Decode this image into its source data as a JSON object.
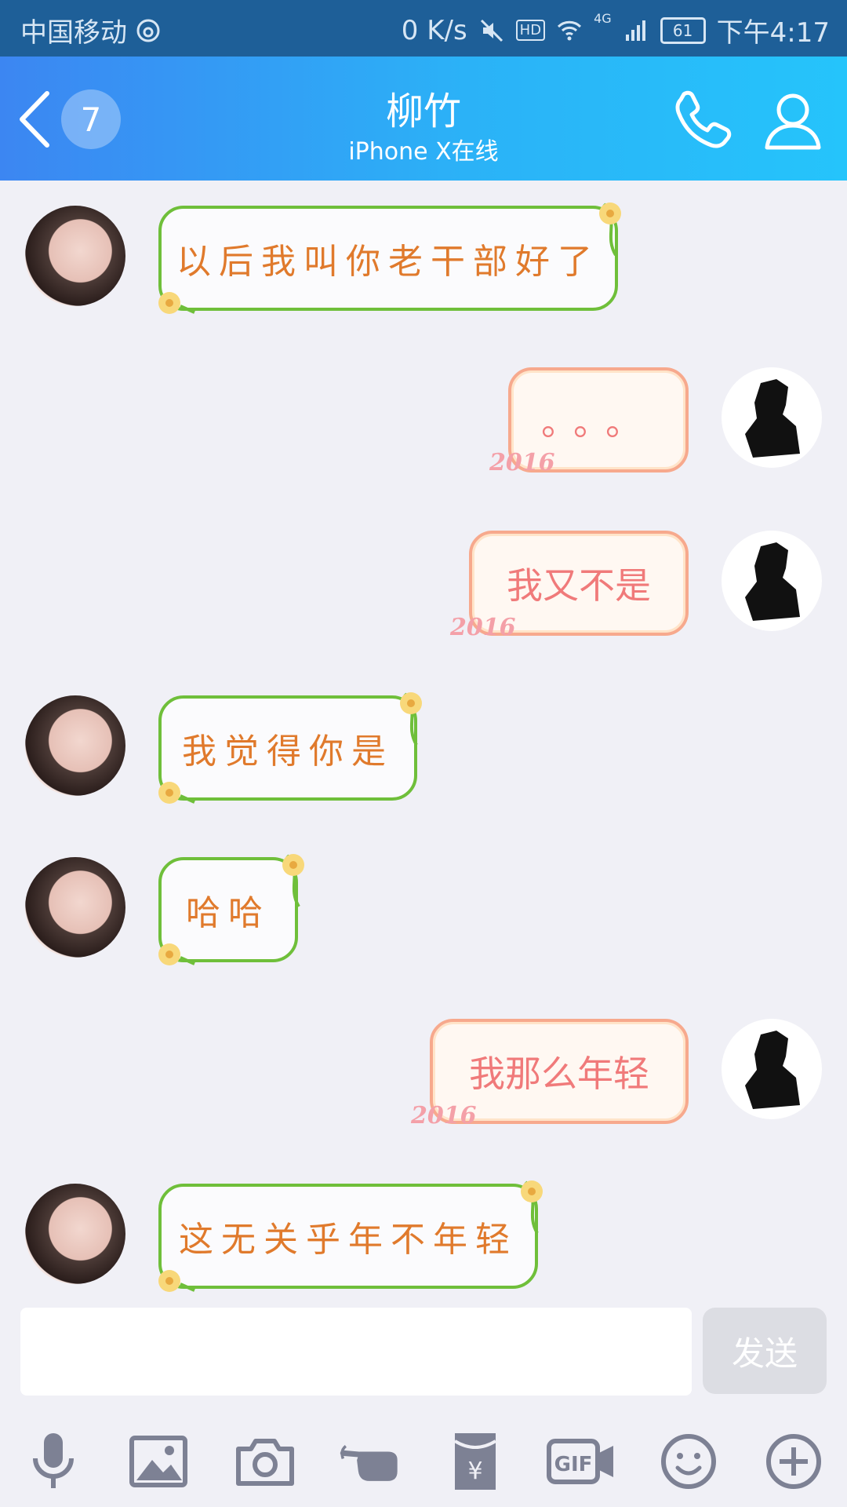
{
  "status_bar": {
    "carrier": "中国移动",
    "speed": "0 K/s",
    "hd_label": "HD",
    "network": "4G",
    "battery": "61",
    "time": "下午4:17"
  },
  "header": {
    "unread_count": "7",
    "contact_name": "柳竹",
    "contact_status": "iPhone X在线"
  },
  "messages": [
    {
      "side": "her",
      "text": "以后我叫你老干部好了"
    },
    {
      "side": "me",
      "text": "。。。"
    },
    {
      "side": "me",
      "text": "我又不是"
    },
    {
      "side": "her",
      "text": "我觉得你是"
    },
    {
      "side": "her",
      "text": "哈哈"
    },
    {
      "side": "me",
      "text": "我那么年轻"
    },
    {
      "side": "her",
      "text": "这无关乎年不年轻"
    }
  ],
  "bubble_stamp": "2016",
  "composer": {
    "input_value": "",
    "send_label": "发送"
  },
  "toolbar": {
    "gif_label": "GIF",
    "items": [
      "mic-icon",
      "image-icon",
      "camera-icon",
      "poke-icon",
      "red-packet-icon",
      "gif-icon",
      "emoji-icon",
      "plus-icon"
    ]
  },
  "colors": {
    "header_start": "#3c86f2",
    "header_end": "#25c4fb",
    "her_bubble_border": "#6fbf3a",
    "her_text": "#e07a2c",
    "my_bubble_border": "#f7a98d",
    "my_text": "#f07a7a"
  }
}
